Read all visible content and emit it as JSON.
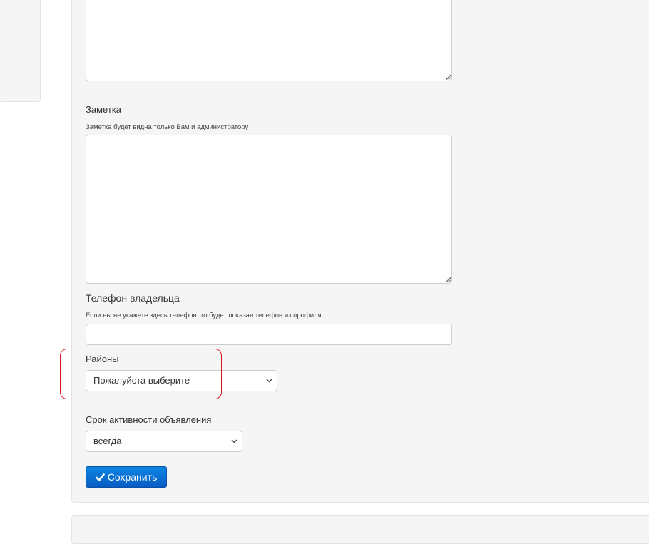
{
  "note_field": {
    "label": "Заметка",
    "hint": "Заметка будет видна только Вам и администратору",
    "value": ""
  },
  "description_field": {
    "value": ""
  },
  "owner_phone": {
    "label": "Телефон владельца",
    "hint": "Если вы не укажете здесь телефон, то будет показан телефон из профиля",
    "value": "",
    "placeholder": ""
  },
  "districts": {
    "label": "Районы",
    "selected": "Пожалуйста выберите"
  },
  "listing_term": {
    "label": "Срок активности объявления",
    "selected": "всегда"
  },
  "save_button": {
    "label": "Сохранить",
    "icon": "check-icon"
  },
  "colors": {
    "primary_button": "#0a6fd6",
    "highlight": "#e0141e",
    "panel_background": "#f5f5f5"
  }
}
